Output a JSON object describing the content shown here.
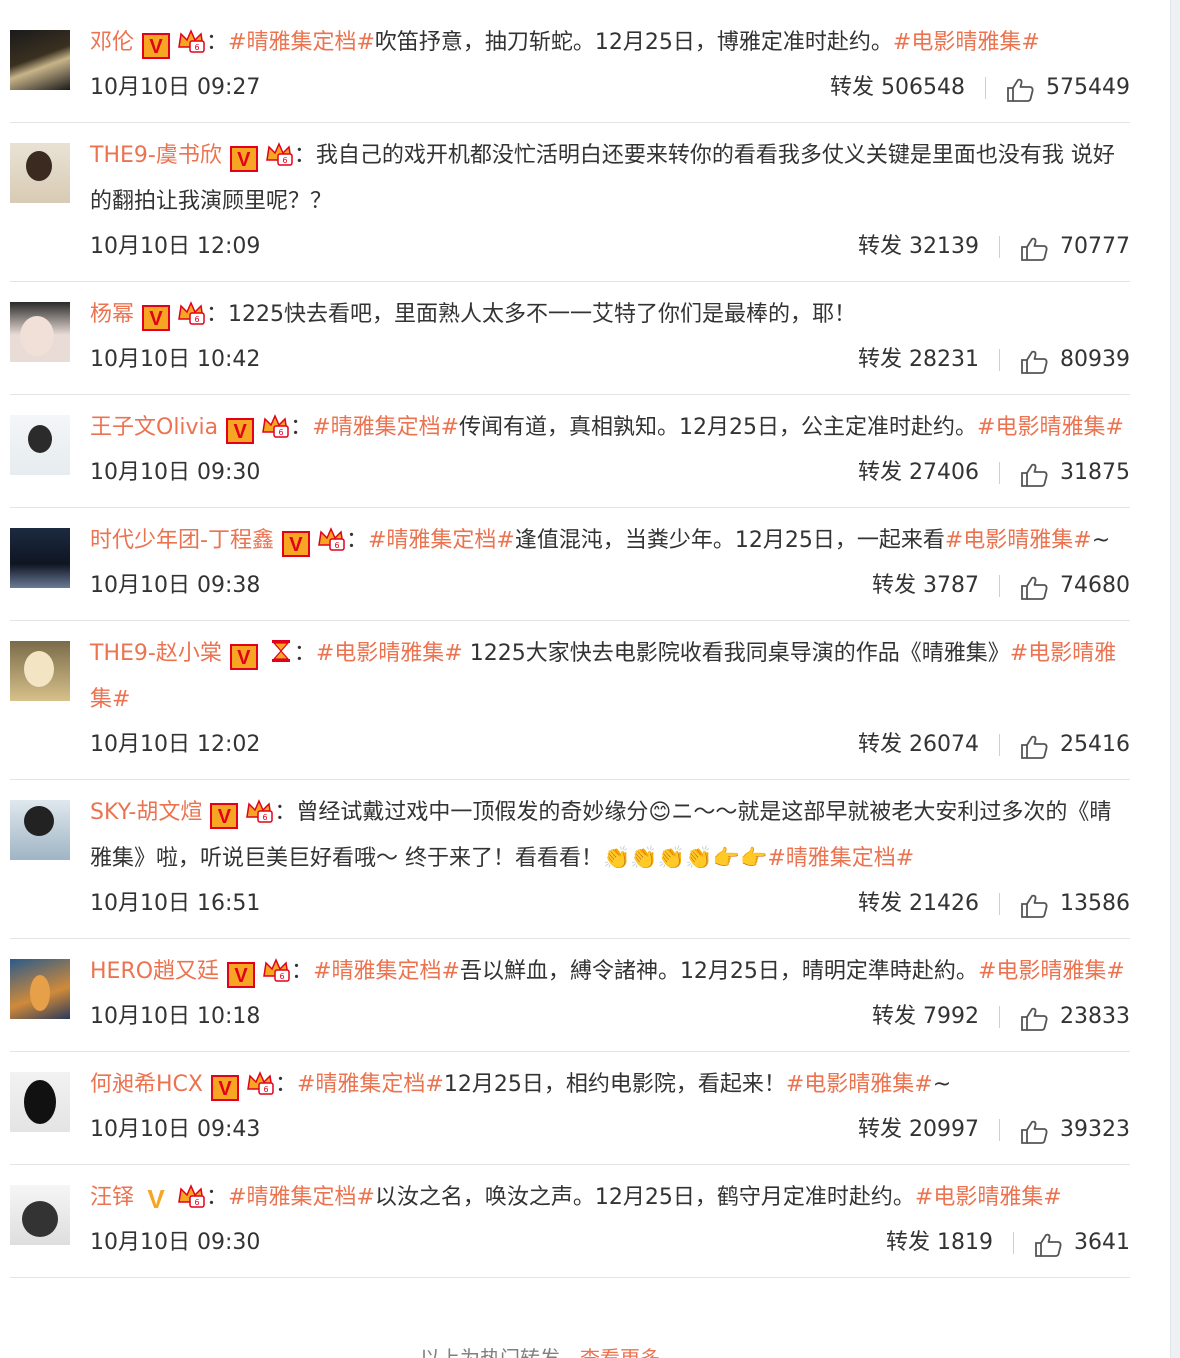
{
  "colors": {
    "username": "#eb7350",
    "tag": "#eb7350",
    "text": "#333333",
    "badge_v": "#f6a623",
    "badge_border": "#e2001a",
    "divider": "#e4e4e4"
  },
  "comments": [
    {
      "user": "邓伦",
      "badge": "V",
      "segments": [
        {
          "type": "tag",
          "text": "#晴雅集定档#"
        },
        {
          "type": "text",
          "text": "吹笛抒意，抽刀斩蛇。12月25日，博雅定准时赴约。"
        },
        {
          "type": "tag",
          "text": "#电影晴雅集#"
        }
      ],
      "time": "10月10日 09:27",
      "repost": "转发 506548",
      "likes": "575449"
    },
    {
      "user": "THE9-虞书欣",
      "badge": "V",
      "segments": [
        {
          "type": "text",
          "text": "我自己的戏开机都没忙活明白还要来转你的看看我多仗义关键是里面也没有我 说好的翻拍让我演顾里呢？？"
        }
      ],
      "time": "10月10日 12:09",
      "repost": "转发 32139",
      "likes": "70777"
    },
    {
      "user": "杨幂",
      "badge": "V",
      "segments": [
        {
          "type": "text",
          "text": "1225快去看吧，里面熟人太多不一一艾特了你们是最棒的，耶！"
        }
      ],
      "time": "10月10日 10:42",
      "repost": "转发 28231",
      "likes": "80939"
    },
    {
      "user": "王子文Olivia",
      "badge": "V",
      "segments": [
        {
          "type": "tag",
          "text": "#晴雅集定档#"
        },
        {
          "type": "text",
          "text": "传闻有道，真相孰知。12月25日，公主定准时赴约。"
        },
        {
          "type": "tag",
          "text": "#电影晴雅集#"
        }
      ],
      "time": "10月10日 09:30",
      "repost": "转发 27406",
      "likes": "31875"
    },
    {
      "user": "时代少年团-丁程鑫",
      "badge": "V",
      "segments": [
        {
          "type": "tag",
          "text": "#晴雅集定档#"
        },
        {
          "type": "text",
          "text": "逢值混沌，当粪少年。12月25日，一起来看"
        },
        {
          "type": "tag",
          "text": "#电影晴雅集#"
        },
        {
          "type": "text",
          "text": "~"
        }
      ],
      "time": "10月10日 09:38",
      "repost": "转发 3787",
      "likes": "74680"
    },
    {
      "user": "THE9-赵小棠",
      "badge": "V",
      "badge2": "hourglass",
      "segments": [
        {
          "type": "tag",
          "text": "#电影晴雅集#"
        },
        {
          "type": "text",
          "text": " 1225大家快去电影院收看我同桌导演的作品《晴雅集》"
        },
        {
          "type": "tag",
          "text": "#电影晴雅集#"
        }
      ],
      "time": "10月10日 12:02",
      "repost": "转发 26074",
      "likes": "25416"
    },
    {
      "user": "SKY-胡文煊",
      "badge": "V",
      "segments": [
        {
          "type": "text",
          "text": "曾经试戴过戏中一顶假发的奇妙缘分😊ニ～～就是这部早就被老大安利过多次的《晴雅集》啦，听说巨美巨好看哦～ 终于来了！看看看！👏👏👏👏👉👉"
        },
        {
          "type": "tag",
          "text": "#晴雅集定档#"
        }
      ],
      "time": "10月10日 16:51",
      "repost": "转发 21426",
      "likes": "13586"
    },
    {
      "user": "HERO趙又廷",
      "badge": "V",
      "segments": [
        {
          "type": "tag",
          "text": "#晴雅集定档#"
        },
        {
          "type": "text",
          "text": "吾以鮮血，縛令諸神。12月25日，晴明定準時赴約。"
        },
        {
          "type": "tag",
          "text": "#电影晴雅集#"
        }
      ],
      "time": "10月10日 10:18",
      "repost": "转发 7992",
      "likes": "23833"
    },
    {
      "user": "何昶希HCX",
      "badge": "V",
      "segments": [
        {
          "type": "tag",
          "text": "#晴雅集定档#"
        },
        {
          "type": "text",
          "text": "12月25日，相约电影院，看起来！"
        },
        {
          "type": "tag",
          "text": "#电影晴雅集#"
        },
        {
          "type": "text",
          "text": "~"
        }
      ],
      "time": "10月10日 09:43",
      "repost": "转发 20997",
      "likes": "39323"
    },
    {
      "user": "汪铎",
      "badge": "V",
      "badge_style": "gold",
      "segments": [
        {
          "type": "tag",
          "text": "#晴雅集定档#"
        },
        {
          "type": "text",
          "text": "以汝之名，唤汝之声。12月25日，鹤守月定准时赴约。"
        },
        {
          "type": "tag",
          "text": "#电影晴雅集#"
        }
      ],
      "time": "10月10日 09:30",
      "repost": "转发 1819",
      "likes": "3641"
    }
  ],
  "footer": {
    "text": "以上为热门转发，",
    "more": "查看更多"
  }
}
